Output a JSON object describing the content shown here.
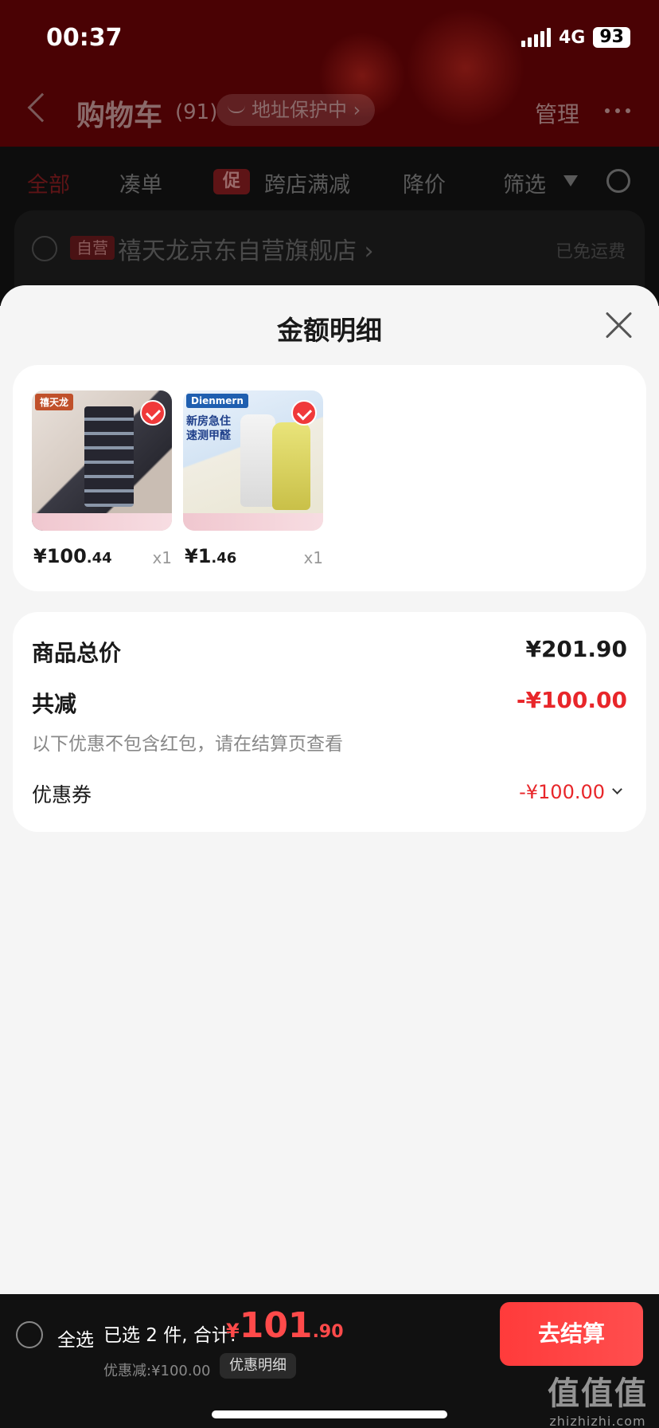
{
  "status_bar": {
    "time": "00:37",
    "network": "4G",
    "battery": "93"
  },
  "background": {
    "title": "购物车",
    "count": "(91)",
    "address_pill": "地址保护中 ›",
    "manage": "管理",
    "tabs": [
      {
        "label": "全部",
        "active": true
      },
      {
        "label": "凑单",
        "active": false
      },
      {
        "label": "跨店满减",
        "active": false,
        "badge": "促"
      },
      {
        "label": "降价",
        "active": false
      },
      {
        "label": "筛选",
        "active": false
      }
    ],
    "store": {
      "badge": "自营",
      "name": "禧天龙京东自营旗舰店 ›",
      "shipping": "已免运费"
    }
  },
  "sheet": {
    "title": "金额明细",
    "products": [
      {
        "brand": "禧天龙",
        "price_int": "¥100",
        "price_dec": ".44",
        "qty": "x1",
        "checked": true
      },
      {
        "brand": "Dienmern",
        "tagline": "新房急住\n速测甲醛",
        "price_int": "¥1",
        "price_dec": ".46",
        "qty": "x1",
        "checked": true
      }
    ],
    "summary": {
      "total_label": "商品总价",
      "total_value": "¥201.90",
      "discount_label": "共减",
      "discount_value": "-¥100.00",
      "note": "以下优惠不包含红包，请在结算页查看",
      "coupon_label": "优惠券",
      "coupon_value": "-¥100.00"
    }
  },
  "bottom_bar": {
    "select_all": "全选",
    "selected_text": "已选 2 件, 合计:",
    "total_currency": "¥",
    "total_int": "101",
    "total_dec": ".90",
    "discount_line": "优惠减:¥100.00",
    "detail_chip": "优惠明细",
    "checkout": "去结算"
  },
  "watermark": {
    "line1": "值值值",
    "line2": "zhizhizhi.com"
  },
  "colors": {
    "accent_red": "#e8262a",
    "header_bg": "#4a0204",
    "checkout": "#ff3b3b"
  }
}
